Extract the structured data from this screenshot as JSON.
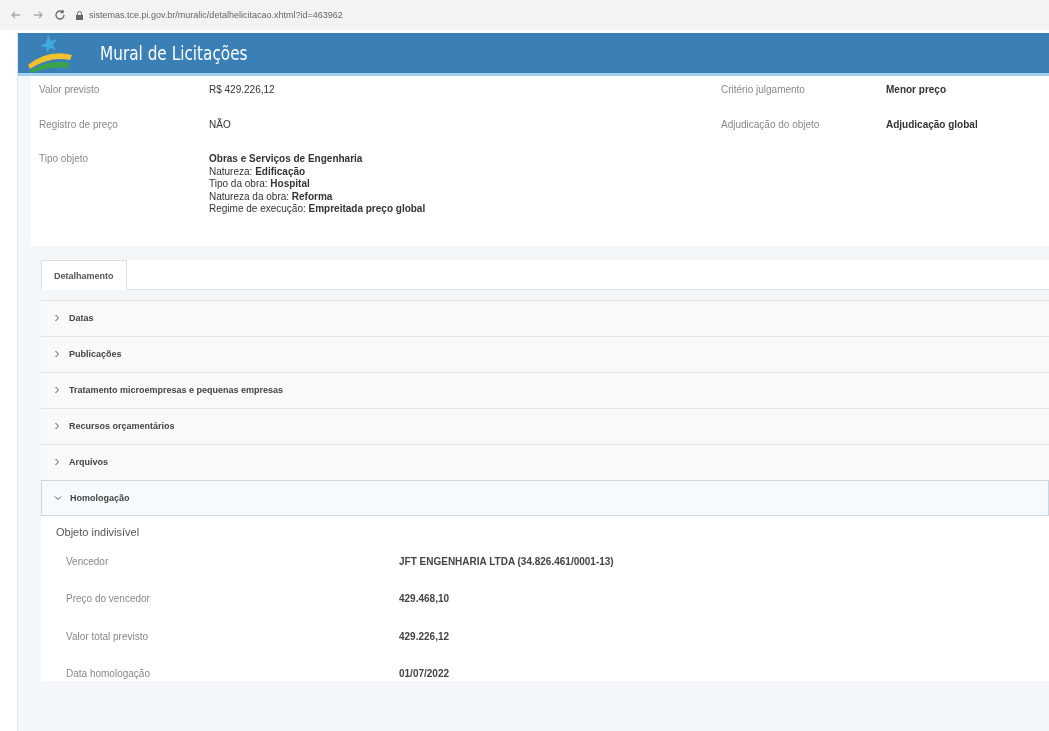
{
  "browser": {
    "url": "sistemas.tce.pi.gov.br/muralic/detalhelicitacao.xhtml?id=463962"
  },
  "header": {
    "title": "Mural de Licitações"
  },
  "summary_left": [
    {
      "label": "Valor previsto",
      "lines": [
        "R$ 429.226,12"
      ]
    },
    {
      "label": "Registro de preço",
      "lines": [
        "NÃO"
      ]
    },
    {
      "label": "Tipo objeto",
      "lines": [
        "**Obras e Serviços de Engenharia**",
        "Natureza: **Edificação**",
        "Tipo da obra: **Hospital**",
        "Natureza da obra: **Reforma**",
        "Regime de execução: **Empreitada preço global**"
      ]
    }
  ],
  "summary_right": [
    {
      "label": "Critério julgamento",
      "value": "Menor preço"
    },
    {
      "label": "Adjudicação do objeto",
      "value": "Adjudicação global"
    }
  ],
  "tabs": [
    {
      "label": "Detalhamento",
      "selected": true
    }
  ],
  "sections": [
    {
      "title": "Datas",
      "expanded": false
    },
    {
      "title": "Publicações",
      "expanded": false
    },
    {
      "title": "Tratamento microempresas e pequenas empresas",
      "expanded": false
    },
    {
      "title": "Recursos orçamentários",
      "expanded": false
    },
    {
      "title": "Arquivos",
      "expanded": false
    },
    {
      "title": "Homologação",
      "expanded": true
    }
  ],
  "homologation": {
    "heading": "Objeto indivisível",
    "rows": [
      {
        "label": "Vencedor",
        "value": "JFT ENGENHARIA LTDA (34.826.461/0001-13)"
      },
      {
        "label": "Preço do vencedor",
        "value": "429.468,10"
      },
      {
        "label": "Valor total previsto",
        "value": "429.226,12"
      },
      {
        "label": "Data homologação",
        "value": "01/07/2022"
      }
    ]
  }
}
